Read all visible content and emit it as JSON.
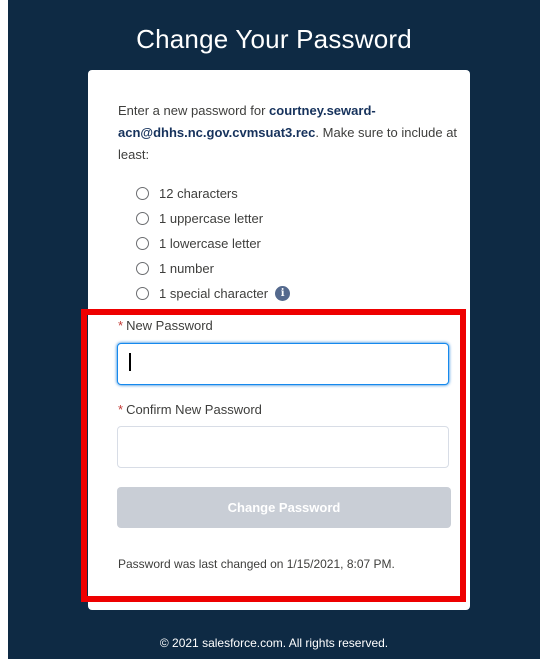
{
  "page": {
    "title": "Change Your Password"
  },
  "intro": {
    "prefix": "Enter a new password for ",
    "username": "courtney.seward-acn@dhhs.nc.gov.cvmsuat3.rec",
    "suffix": ". Make sure to include at least:"
  },
  "requirements": [
    "12 characters",
    "1 uppercase letter",
    "1 lowercase letter",
    "1 number",
    "1 special character"
  ],
  "info_icon": {
    "icon": "info-icon",
    "glyph": "i"
  },
  "form": {
    "required_mark": "*",
    "new_password_label": "New Password",
    "new_password_value": "",
    "confirm_password_label": "Confirm New Password",
    "confirm_password_value": "",
    "submit_label": "Change Password"
  },
  "last_changed": "Password was last changed on 1/15/2021, 8:07 PM.",
  "footer": "© 2021 salesforce.com. All rights reserved.",
  "colors": {
    "background": "#0e2a44",
    "accent_focus": "#1589ee",
    "required": "#c23934",
    "disabled_button": "#c9ced6",
    "annotation_box": "#ee0000"
  }
}
